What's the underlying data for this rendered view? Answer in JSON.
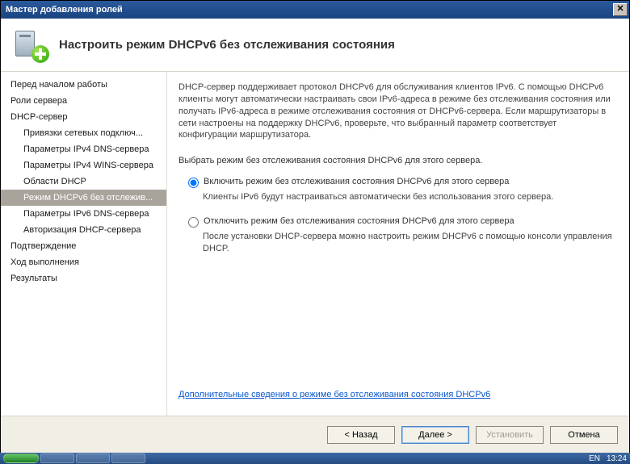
{
  "title": "Мастер добавления ролей",
  "heading": "Настроить режим DHCPv6 без отслеживания состояния",
  "nav": {
    "items": [
      {
        "label": "Перед началом работы",
        "sub": false
      },
      {
        "label": "Роли сервера",
        "sub": false
      },
      {
        "label": "DHCP-сервер",
        "sub": false
      },
      {
        "label": "Привязки сетевых подключ...",
        "sub": true
      },
      {
        "label": "Параметры IPv4 DNS-сервера",
        "sub": true
      },
      {
        "label": "Параметры IPv4 WINS-сервера",
        "sub": true
      },
      {
        "label": "Области DHCP",
        "sub": true
      },
      {
        "label": "Режим DHCPv6 без отслежив...",
        "sub": true,
        "selected": true
      },
      {
        "label": "Параметры IPv6 DNS-сервера",
        "sub": true
      },
      {
        "label": "Авторизация DHCP-сервера",
        "sub": true
      },
      {
        "label": "Подтверждение",
        "sub": false
      },
      {
        "label": "Ход выполнения",
        "sub": false
      },
      {
        "label": "Результаты",
        "sub": false
      }
    ]
  },
  "content": {
    "desc": "DHCP-сервер поддерживает протокол DHCPv6 для обслуживания клиентов IPv6. С помощью DHCPv6 клиенты могут автоматически настраивать свои IPv6-адреса в режиме без отслеживания состояния или получать IPv6-адреса в режиме отслеживания состояния от DHCPv6-сервера. Если маршрутизаторы в сети настроены на поддержку DHCPv6, проверьте, что выбранный параметр соответствует конфигурации маршрутизатора.",
    "prompt": "Выбрать режим без отслеживания состояния DHCPv6 для этого сервера.",
    "opt1": {
      "label": "Включить режим без отслеживания состояния DHCPv6 для этого сервера",
      "sub": "Клиенты IPv6 будут настраиваться автоматически без использования этого сервера."
    },
    "opt2": {
      "label": "Отключить режим без отслеживания состояния DHCPv6 для этого сервера",
      "sub": "После установки DHCP-сервера можно настроить режим DHCPv6 с помощью консоли управления DHCP."
    },
    "link": "Дополнительные сведения о режиме без отслеживания состояния DHCPv6"
  },
  "footer": {
    "back": "< Назад",
    "next": "Далее >",
    "install": "Установить",
    "cancel": "Отмена"
  },
  "taskbar": {
    "lang": "EN",
    "time": "13:24"
  }
}
